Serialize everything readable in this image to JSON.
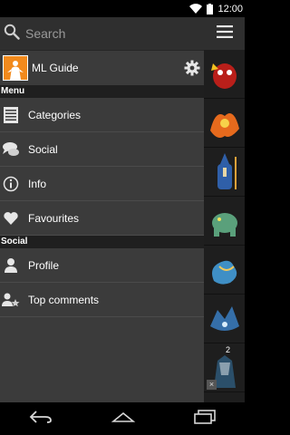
{
  "status": {
    "time": "12:00"
  },
  "search": {
    "placeholder": "Search"
  },
  "header": {
    "title": "ML Guide"
  },
  "menu_section": {
    "label": "Menu"
  },
  "menu_items": [
    {
      "label": "Categories",
      "icon": "list-icon"
    },
    {
      "label": "Social",
      "icon": "chat-icon"
    },
    {
      "label": "Info",
      "icon": "info-icon"
    },
    {
      "label": "Favourites",
      "icon": "heart-icon"
    }
  ],
  "social_section": {
    "label": "Social"
  },
  "social_items": [
    {
      "label": "Profile",
      "icon": "user-icon"
    },
    {
      "label": "Top comments",
      "icon": "users-star-icon"
    }
  ],
  "right_strip": {
    "badge": "2",
    "close_glyph": "×",
    "thumb_colors": [
      "#b91f1a",
      "#e66a1d",
      "#2f5fa8",
      "#5aa07b",
      "#3f8fc5",
      "#356fa9",
      "#2b4f6a"
    ]
  }
}
